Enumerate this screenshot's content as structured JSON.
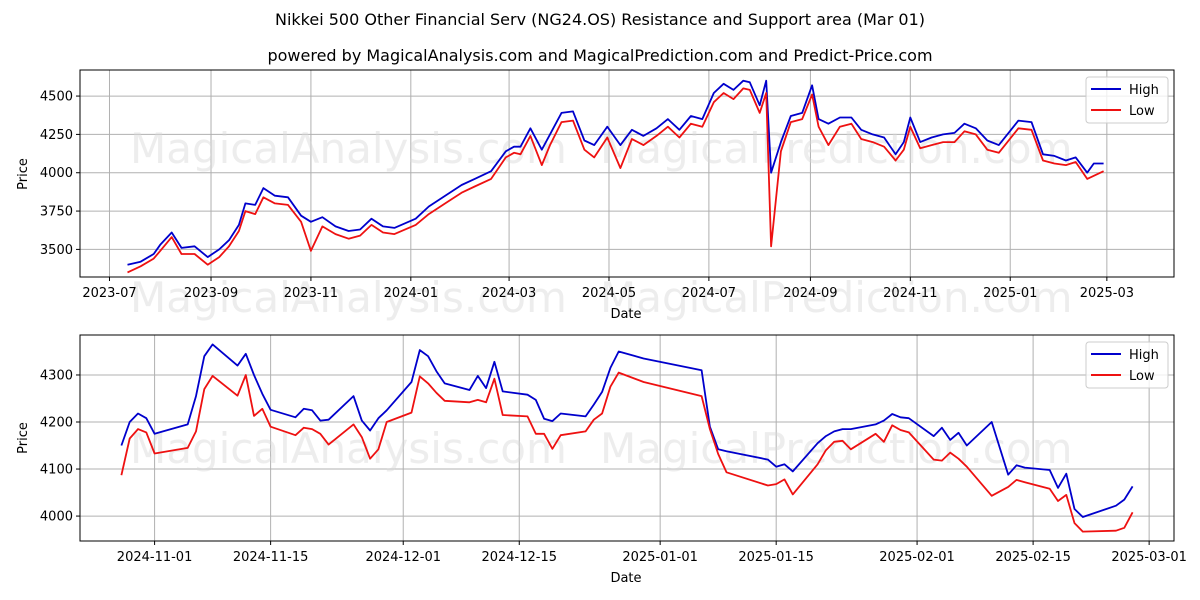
{
  "title": "Nikkei 500 Other Financial Serv (NG24.OS) Resistance and Support area (Mar 01)",
  "subtitle": "powered by MagicalAnalysis.com and MagicalPrediction.com and Predict-Price.com",
  "watermarks": [
    "MagicalAnalysis.com",
    "MagicalPrediction.com"
  ],
  "colors": {
    "high": "#0000cc",
    "low": "#ee1111",
    "grid": "#b0b0b0"
  },
  "chart_data": [
    {
      "type": "line",
      "title": "",
      "xlabel": "Date",
      "ylabel": "Price",
      "grid": true,
      "legend": {
        "placement": "top-right",
        "entries": [
          "High",
          "Low"
        ]
      },
      "ylim": [
        3320,
        4670
      ],
      "yticks": [
        3500,
        3750,
        4000,
        4250,
        4500
      ],
      "xlim": [
        "2023-06-13",
        "2025-04-11"
      ],
      "xticks": [
        "2023-07",
        "2023-09",
        "2023-11",
        "2024-01",
        "2024-03",
        "2024-05",
        "2024-07",
        "2024-09",
        "2024-11",
        "2025-01",
        "2025-03"
      ],
      "x": [
        "2023-07-12",
        "2023-07-20",
        "2023-07-28",
        "2023-08-01",
        "2023-08-08",
        "2023-08-14",
        "2023-08-22",
        "2023-08-30",
        "2023-09-06",
        "2023-09-12",
        "2023-09-18",
        "2023-09-22",
        "2023-09-28",
        "2023-10-03",
        "2023-10-10",
        "2023-10-18",
        "2023-10-26",
        "2023-11-01",
        "2023-11-08",
        "2023-11-16",
        "2023-11-24",
        "2023-12-01",
        "2023-12-08",
        "2023-12-15",
        "2023-12-22",
        "2024-01-04",
        "2024-01-12",
        "2024-01-22",
        "2024-02-01",
        "2024-02-09",
        "2024-02-19",
        "2024-02-28",
        "2024-03-04",
        "2024-03-08",
        "2024-03-14",
        "2024-03-21",
        "2024-03-26",
        "2024-04-02",
        "2024-04-09",
        "2024-04-16",
        "2024-04-22",
        "2024-04-30",
        "2024-05-08",
        "2024-05-15",
        "2024-05-22",
        "2024-05-30",
        "2024-06-06",
        "2024-06-13",
        "2024-06-20",
        "2024-06-27",
        "2024-07-04",
        "2024-07-10",
        "2024-07-16",
        "2024-07-22",
        "2024-07-26",
        "2024-08-01",
        "2024-08-05",
        "2024-08-08",
        "2024-08-14",
        "2024-08-20",
        "2024-08-27",
        "2024-09-02",
        "2024-09-06",
        "2024-09-12",
        "2024-09-19",
        "2024-09-26",
        "2024-10-02",
        "2024-10-09",
        "2024-10-16",
        "2024-10-23",
        "2024-10-28",
        "2024-11-01",
        "2024-11-07",
        "2024-11-14",
        "2024-11-21",
        "2024-11-28",
        "2024-12-04",
        "2024-12-11",
        "2024-12-18",
        "2024-12-25",
        "2025-01-06",
        "2025-01-14",
        "2025-01-21",
        "2025-01-28",
        "2025-02-04",
        "2025-02-10",
        "2025-02-17",
        "2025-02-21",
        "2025-02-27"
      ],
      "series": [
        {
          "name": "High",
          "values": [
            3400,
            3420,
            3470,
            3530,
            3610,
            3510,
            3520,
            3450,
            3500,
            3560,
            3660,
            3800,
            3790,
            3900,
            3850,
            3840,
            3720,
            3680,
            3710,
            3650,
            3620,
            3630,
            3700,
            3650,
            3640,
            3700,
            3780,
            3850,
            3920,
            3960,
            4010,
            4140,
            4170,
            4170,
            4290,
            4150,
            4250,
            4390,
            4400,
            4210,
            4180,
            4300,
            4180,
            4280,
            4240,
            4290,
            4350,
            4280,
            4370,
            4350,
            4520,
            4580,
            4540,
            4600,
            4590,
            4440,
            4600,
            4000,
            4200,
            4370,
            4390,
            4570,
            4350,
            4320,
            4360,
            4360,
            4280,
            4250,
            4230,
            4120,
            4200,
            4360,
            4200,
            4230,
            4250,
            4260,
            4320,
            4290,
            4210,
            4180,
            4340,
            4330,
            4120,
            4110,
            4080,
            4100,
            4000,
            4060,
            4060
          ]
        },
        {
          "name": "Low",
          "values": [
            3350,
            3390,
            3440,
            3490,
            3580,
            3470,
            3470,
            3400,
            3450,
            3520,
            3620,
            3750,
            3730,
            3840,
            3800,
            3790,
            3680,
            3490,
            3650,
            3600,
            3570,
            3590,
            3660,
            3610,
            3600,
            3660,
            3730,
            3800,
            3870,
            3910,
            3960,
            4100,
            4130,
            4120,
            4240,
            4050,
            4180,
            4330,
            4340,
            4150,
            4100,
            4230,
            4030,
            4220,
            4180,
            4240,
            4300,
            4230,
            4320,
            4300,
            4460,
            4520,
            4480,
            4550,
            4540,
            4390,
            4520,
            3520,
            4140,
            4330,
            4350,
            4510,
            4300,
            4180,
            4300,
            4320,
            4220,
            4200,
            4170,
            4080,
            4150,
            4300,
            4160,
            4180,
            4200,
            4200,
            4270,
            4250,
            4150,
            4130,
            4290,
            4280,
            4080,
            4060,
            4050,
            4070,
            3960,
            3980,
            4010
          ]
        }
      ]
    },
    {
      "type": "line",
      "title": "",
      "xlabel": "Date",
      "ylabel": "Price",
      "grid": true,
      "legend": {
        "placement": "top-right",
        "entries": [
          "High",
          "Low"
        ]
      },
      "ylim": [
        3947,
        4385
      ],
      "yticks": [
        4000,
        4100,
        4200,
        4300
      ],
      "xlim": [
        "2024-10-23",
        "2025-03-04"
      ],
      "xticks": [
        "2024-11-01",
        "2024-11-15",
        "2024-12-01",
        "2024-12-15",
        "2025-01-01",
        "2025-01-15",
        "2025-02-01",
        "2025-02-15",
        "2025-03-01"
      ],
      "x": [
        "2024-10-28",
        "2024-10-29",
        "2024-10-30",
        "2024-10-31",
        "2024-11-01",
        "2024-11-05",
        "2024-11-06",
        "2024-11-07",
        "2024-11-08",
        "2024-11-11",
        "2024-11-12",
        "2024-11-13",
        "2024-11-14",
        "2024-11-15",
        "2024-11-18",
        "2024-11-19",
        "2024-11-20",
        "2024-11-21",
        "2024-11-22",
        "2024-11-25",
        "2024-11-26",
        "2024-11-27",
        "2024-11-28",
        "2024-11-29",
        "2024-12-02",
        "2024-12-03",
        "2024-12-04",
        "2024-12-05",
        "2024-12-06",
        "2024-12-09",
        "2024-12-10",
        "2024-12-11",
        "2024-12-12",
        "2024-12-13",
        "2024-12-16",
        "2024-12-17",
        "2024-12-18",
        "2024-12-19",
        "2024-12-20",
        "2024-12-23",
        "2024-12-24",
        "2024-12-25",
        "2024-12-26",
        "2024-12-27",
        "2024-12-30",
        "2025-01-06",
        "2025-01-07",
        "2025-01-08",
        "2025-01-09",
        "2025-01-14",
        "2025-01-15",
        "2025-01-16",
        "2025-01-17",
        "2025-01-20",
        "2025-01-21",
        "2025-01-22",
        "2025-01-23",
        "2025-01-24",
        "2025-01-27",
        "2025-01-28",
        "2025-01-29",
        "2025-01-30",
        "2025-01-31",
        "2025-02-03",
        "2025-02-04",
        "2025-02-05",
        "2025-02-06",
        "2025-02-07",
        "2025-02-10",
        "2025-02-12",
        "2025-02-13",
        "2025-02-14",
        "2025-02-17",
        "2025-02-18",
        "2025-02-19",
        "2025-02-20",
        "2025-02-21",
        "2025-02-25",
        "2025-02-26",
        "2025-02-27"
      ],
      "series": [
        {
          "name": "High",
          "values": [
            4150,
            4200,
            4218,
            4208,
            4175,
            4195,
            4255,
            4340,
            4365,
            4320,
            4345,
            4300,
            4260,
            4226,
            4210,
            4228,
            4225,
            4203,
            4205,
            4255,
            4203,
            4182,
            4208,
            4225,
            4285,
            4353,
            4340,
            4308,
            4282,
            4268,
            4298,
            4272,
            4328,
            4265,
            4258,
            4247,
            4207,
            4202,
            4218,
            4212,
            4237,
            4264,
            4315,
            4350,
            4335,
            4310,
            4190,
            4142,
            4138,
            4120,
            4105,
            4110,
            4095,
            4155,
            4170,
            4180,
            4185,
            4185,
            4195,
            4203,
            4217,
            4210,
            4208,
            4170,
            4188,
            4162,
            4177,
            4150,
            4200,
            4088,
            4108,
            4103,
            4098,
            4060,
            4090,
            4015,
            3998,
            4022,
            4035,
            4063
          ]
        },
        {
          "name": "Low",
          "values": [
            4087,
            4165,
            4185,
            4178,
            4133,
            4145,
            4180,
            4270,
            4298,
            4256,
            4300,
            4213,
            4228,
            4190,
            4172,
            4188,
            4185,
            4175,
            4152,
            4195,
            4168,
            4122,
            4142,
            4200,
            4220,
            4297,
            4282,
            4262,
            4245,
            4242,
            4247,
            4242,
            4292,
            4215,
            4212,
            4175,
            4175,
            4143,
            4172,
            4180,
            4205,
            4218,
            4275,
            4305,
            4285,
            4255,
            4185,
            4132,
            4093,
            4065,
            4068,
            4078,
            4046,
            4110,
            4140,
            4158,
            4160,
            4142,
            4175,
            4158,
            4193,
            4183,
            4178,
            4120,
            4118,
            4135,
            4122,
            4105,
            4043,
            4062,
            4077,
            4072,
            4058,
            4032,
            4045,
            3985,
            3967,
            3969,
            3975,
            4008
          ]
        }
      ]
    }
  ]
}
